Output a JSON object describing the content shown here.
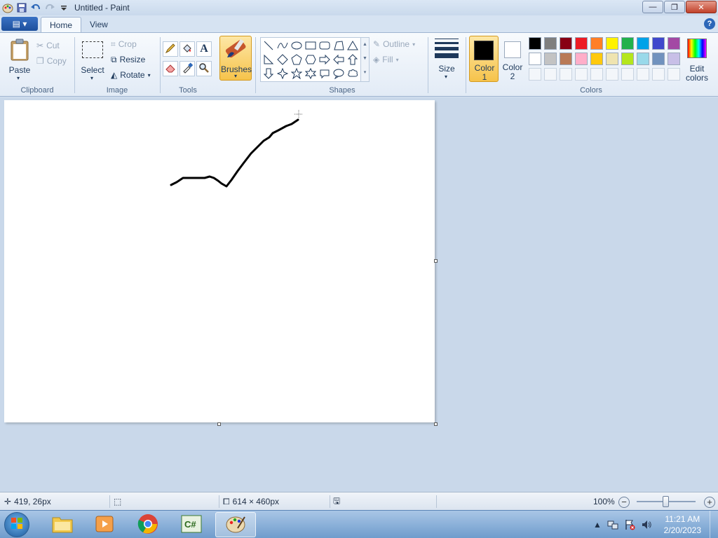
{
  "window": {
    "title": "Untitled - Paint",
    "minimize": "—",
    "restore": "❐",
    "close": "✕"
  },
  "tabs": {
    "file_menu": "▤ ▾",
    "home": "Home",
    "view": "View",
    "help": "?"
  },
  "clipboard": {
    "paste": "Paste",
    "cut": "Cut",
    "copy": "Copy",
    "label": "Clipboard"
  },
  "image": {
    "select": "Select",
    "crop": "Crop",
    "resize": "Resize",
    "rotate": "Rotate",
    "label": "Image"
  },
  "tools": {
    "label": "Tools"
  },
  "brushes": {
    "label": "Brushes"
  },
  "shapes": {
    "outline": "Outline",
    "fill": "Fill",
    "label": "Shapes"
  },
  "size": {
    "label": "Size"
  },
  "colors": {
    "color1_label": "Color",
    "color1_num": "1",
    "color2_label": "Color",
    "color2_num": "2",
    "edit_label": "Edit",
    "edit_label2": "colors",
    "label": "Colors",
    "color1": "#000000",
    "color2": "#ffffff",
    "palette_row1": [
      "#000000",
      "#7f7f7f",
      "#880015",
      "#ed1c24",
      "#ff7f27",
      "#fff200",
      "#22b14c",
      "#00a2e8",
      "#3f48cc",
      "#a349a4"
    ],
    "palette_row2": [
      "#ffffff",
      "#c3c3c3",
      "#b97a57",
      "#ffaec9",
      "#ffc90e",
      "#efe4b0",
      "#b5e61d",
      "#99d9ea",
      "#7092be",
      "#c8bfe7"
    ]
  },
  "status": {
    "cursor_pos": "419, 26px",
    "selection_size": "",
    "canvas_size": "614 × 460px",
    "zoom": "100%"
  },
  "taskbar": {
    "time": "11:21 AM",
    "date": "2/20/2023"
  }
}
